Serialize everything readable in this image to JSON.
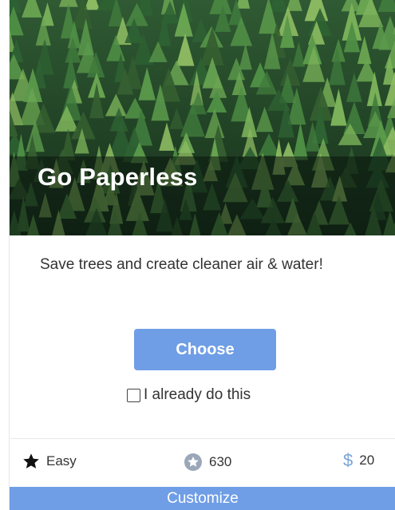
{
  "card": {
    "title": "Go Paperless",
    "description": "Save trees and create cleaner air & water!",
    "choose_label": "Choose",
    "already_label": "I already do this",
    "already_checked": false,
    "difficulty": "Easy",
    "points": "630",
    "cost_symbol": "$",
    "cost": "20",
    "customize_label": "Customize"
  },
  "icons": {
    "difficulty": "star-icon",
    "points": "points-star-badge-icon",
    "cost": "dollar-icon"
  },
  "colors": {
    "accent": "#6f9ee6",
    "text": "#333333",
    "dollar": "#7aa4d8"
  }
}
